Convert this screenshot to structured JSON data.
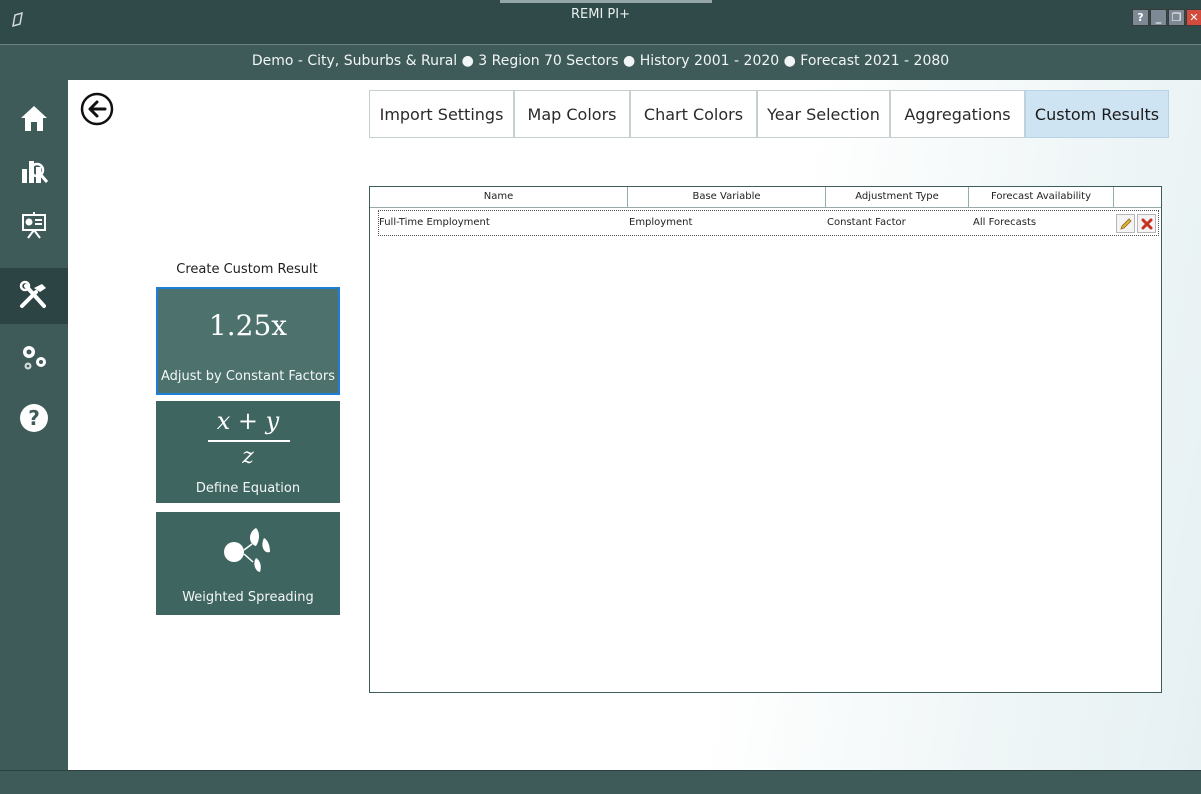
{
  "window": {
    "title": "REMI PI+",
    "buttons": {
      "help": "?",
      "minimize": "_",
      "restore": "❐",
      "close": "✕"
    }
  },
  "subtitle": "Demo - City, Suburbs & Rural ● 3 Region 70 Sectors ● History 2001 - 2020 ● Forecast 2021 - 2080",
  "sidebar": {
    "items": [
      {
        "icon": "home-icon"
      },
      {
        "icon": "results-chart-icon"
      },
      {
        "icon": "presentation-icon"
      },
      {
        "icon": "tools-icon",
        "active": true
      },
      {
        "icon": "settings-gears-icon"
      },
      {
        "icon": "help-icon"
      }
    ]
  },
  "tabs": [
    {
      "label": "Import Settings"
    },
    {
      "label": "Map Colors"
    },
    {
      "label": "Chart Colors"
    },
    {
      "label": "Year Selection"
    },
    {
      "label": "Aggregations"
    },
    {
      "label": "Custom Results",
      "active": true
    }
  ],
  "create": {
    "title": "Create Custom Result",
    "tiles": [
      {
        "math": "1.25x",
        "label": "Adjust by Constant Factors",
        "selected": true
      },
      {
        "math_num": "x + y",
        "math_den": "z",
        "label": "Define Equation"
      },
      {
        "icon": "weighted-spreading-icon",
        "label": "Weighted Spreading"
      }
    ]
  },
  "table": {
    "columns": [
      "Name",
      "Base Variable",
      "Adjustment Type",
      "Forecast Availability"
    ],
    "rows": [
      {
        "name": "Full-Time Employment",
        "base_variable": "Employment",
        "adjustment_type": "Constant Factor",
        "forecast_availability": "All Forecasts"
      }
    ]
  },
  "colors": {
    "sidebar": "#3e5b59",
    "active_tab": "#cfe4f3",
    "tile": "#3f6561",
    "selected_border": "#1d7fd6",
    "close_button": "#d24b3c"
  }
}
